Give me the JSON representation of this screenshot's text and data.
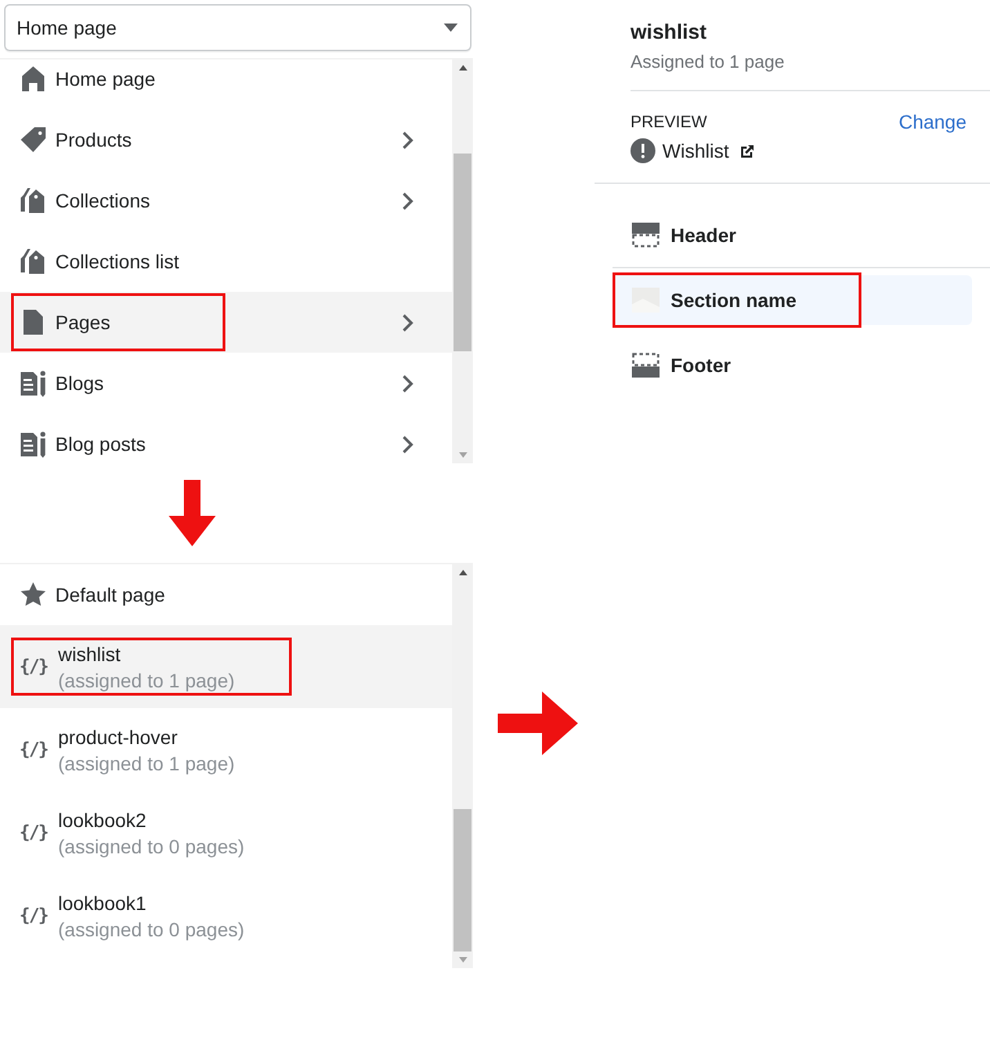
{
  "template_select": {
    "value": "Home page"
  },
  "page_types": [
    {
      "label": "Home page",
      "kind": "home",
      "has_children": false,
      "selected": false,
      "annotated": false
    },
    {
      "label": "Products",
      "kind": "tag",
      "has_children": true,
      "selected": false,
      "annotated": false
    },
    {
      "label": "Collections",
      "kind": "tags",
      "has_children": true,
      "selected": false,
      "annotated": false
    },
    {
      "label": "Collections list",
      "kind": "tags",
      "has_children": false,
      "selected": false,
      "annotated": false
    },
    {
      "label": "Pages",
      "kind": "page",
      "has_children": true,
      "selected": true,
      "annotated": true
    },
    {
      "label": "Blogs",
      "kind": "blog",
      "has_children": true,
      "selected": false,
      "annotated": false
    },
    {
      "label": "Blog posts",
      "kind": "blog",
      "has_children": true,
      "selected": false,
      "annotated": false
    }
  ],
  "templates": [
    {
      "kind": "default",
      "label": "Default page",
      "selected": false,
      "annotated": false
    },
    {
      "kind": "custom",
      "icon_text": "{/}",
      "label": "wishlist",
      "note": "(assigned to 1 page)",
      "selected": true,
      "annotated": true
    },
    {
      "kind": "custom",
      "icon_text": "{/}",
      "label": "product-hover",
      "note": "(assigned to 1 page)",
      "selected": false,
      "annotated": false
    },
    {
      "kind": "custom",
      "icon_text": "{/}",
      "label": "lookbook2",
      "note": "(assigned to 0 pages)",
      "selected": false,
      "annotated": false
    },
    {
      "kind": "custom",
      "icon_text": "{/}",
      "label": "lookbook1",
      "note": "(assigned to 0 pages)",
      "selected": false,
      "annotated": false
    }
  ],
  "template_panel": {
    "title": "wishlist",
    "subtitle": "Assigned to 1 page",
    "preview_label": "PREVIEW",
    "change_link": "Change",
    "preview_page": "Wishlist",
    "sections": [
      {
        "label": "Header",
        "kind": "header",
        "selected": false,
        "annotated": false
      },
      {
        "label": "Section name",
        "kind": "section",
        "selected": true,
        "annotated": true
      },
      {
        "label": "Footer",
        "kind": "footer",
        "selected": false,
        "annotated": false
      }
    ]
  }
}
